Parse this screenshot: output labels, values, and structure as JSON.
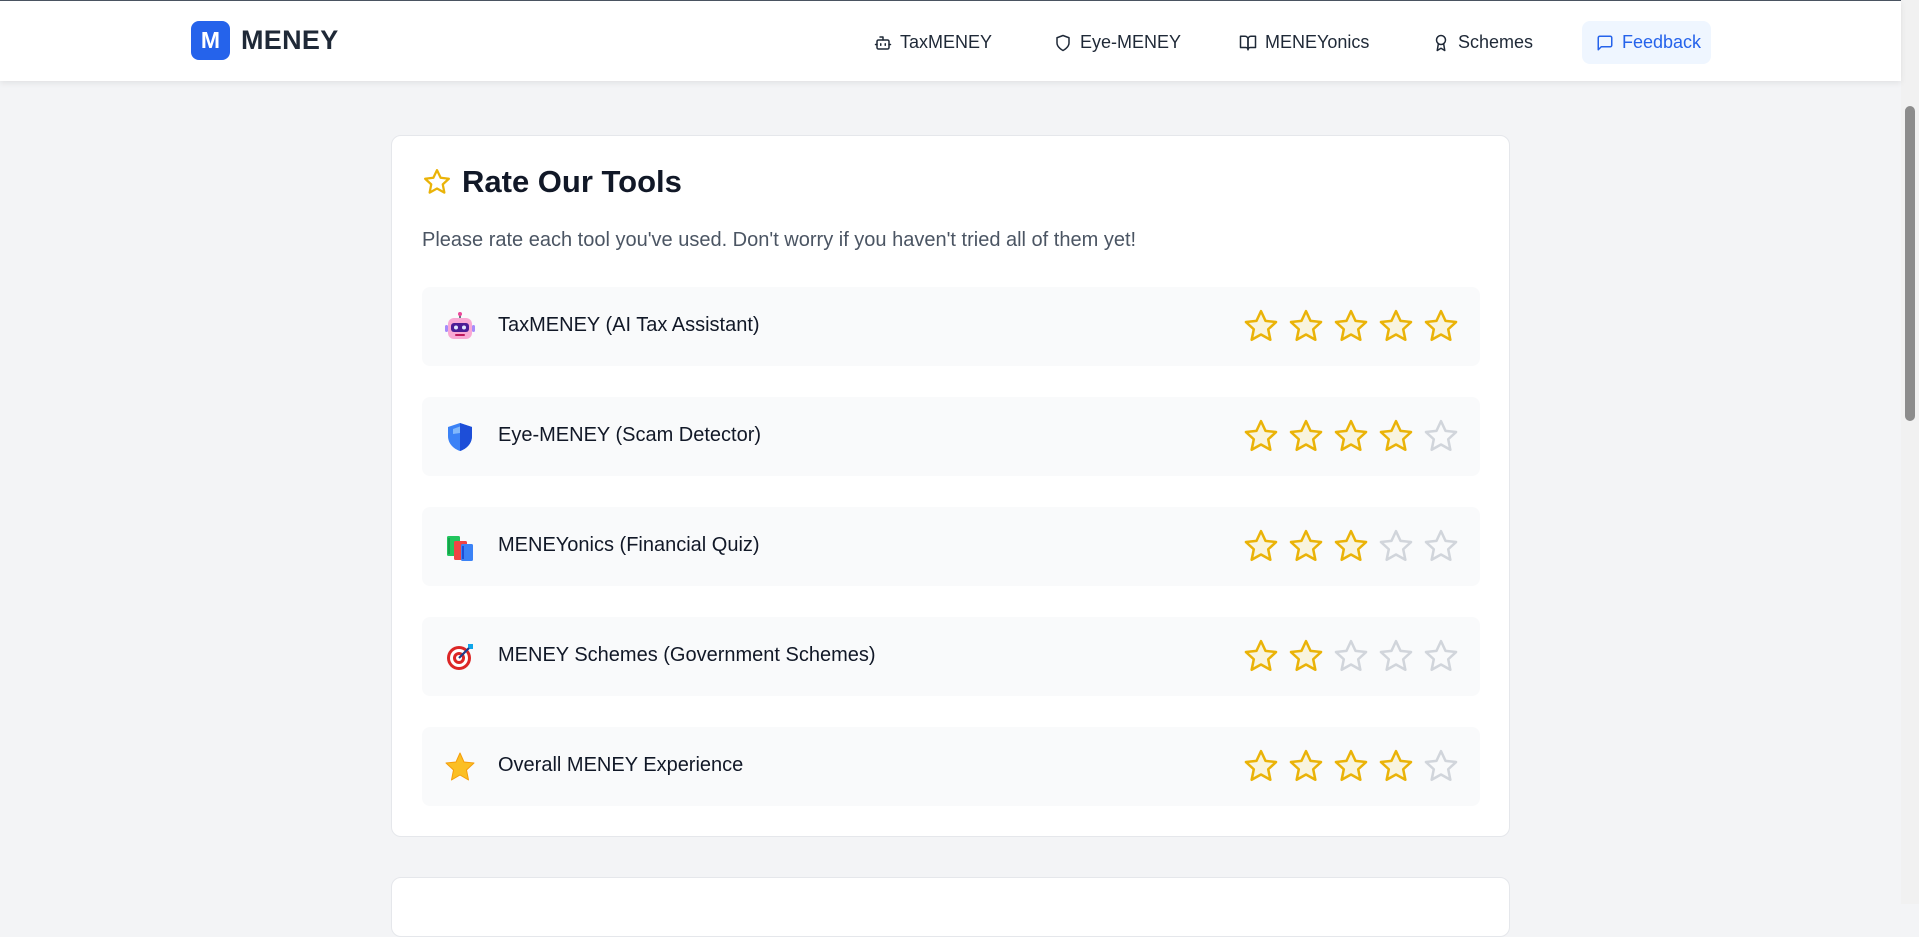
{
  "brand": {
    "logo_letter": "M",
    "name": "MENEY"
  },
  "nav": [
    {
      "label": "TaxMENEY",
      "icon": "robot-icon",
      "active": false
    },
    {
      "label": "Eye-MENEY",
      "icon": "shield-icon",
      "active": false
    },
    {
      "label": "MENEYonics",
      "icon": "book-icon",
      "active": false
    },
    {
      "label": "Schemes",
      "icon": "award-icon",
      "active": false
    },
    {
      "label": "Feedback",
      "icon": "message-square-icon",
      "active": true
    }
  ],
  "card": {
    "title": "Rate Our Tools",
    "subtitle": "Please rate each tool you've used. Don't worry if you haven't tried all of them yet!"
  },
  "tools": [
    {
      "label": "TaxMENEY (AI Tax Assistant)",
      "icon": "robot-emoji-icon",
      "rating": 5,
      "max": 5
    },
    {
      "label": "Eye-MENEY (Scam Detector)",
      "icon": "shield-emoji-icon",
      "rating": 4,
      "max": 5
    },
    {
      "label": "MENEYonics (Financial Quiz)",
      "icon": "books-emoji-icon",
      "rating": 3,
      "max": 5
    },
    {
      "label": "MENEY Schemes (Government Schemes)",
      "icon": "target-emoji-icon",
      "rating": 2,
      "max": 5
    },
    {
      "label": "Overall MENEY Experience",
      "icon": "star-emoji-icon",
      "rating": 4,
      "max": 5
    }
  ],
  "colors": {
    "accent": "#2563eb",
    "star_filled": "#facc15",
    "star_filled_stroke": "#eab308",
    "star_empty_stroke": "#d1d5db"
  }
}
